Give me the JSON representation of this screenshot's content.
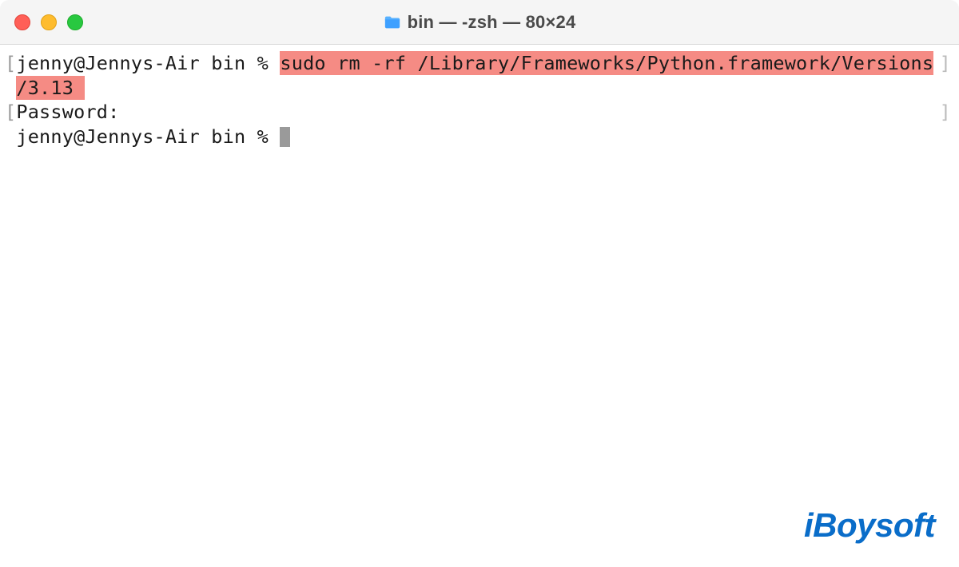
{
  "window": {
    "title": "bin — -zsh — 80×24",
    "traffic_lights": {
      "close": "close-window",
      "minimize": "minimize-window",
      "maximize": "maximize-window"
    }
  },
  "terminal": {
    "line1": {
      "bracket_open": "[",
      "prompt": "jenny@Jennys-Air bin % ",
      "highlighted_cmd_part1": "sudo rm -rf /Library/Frameworks/Python.framework/Versions",
      "bracket_close": "]"
    },
    "line2": {
      "highlighted_cmd_part2": "/3.13 "
    },
    "line3": {
      "bracket_open": "[",
      "text": "Password:",
      "bracket_close": "]"
    },
    "line4": {
      "prompt": " jenny@Jennys-Air bin % "
    }
  },
  "watermark": {
    "text": "iBoysoft"
  }
}
